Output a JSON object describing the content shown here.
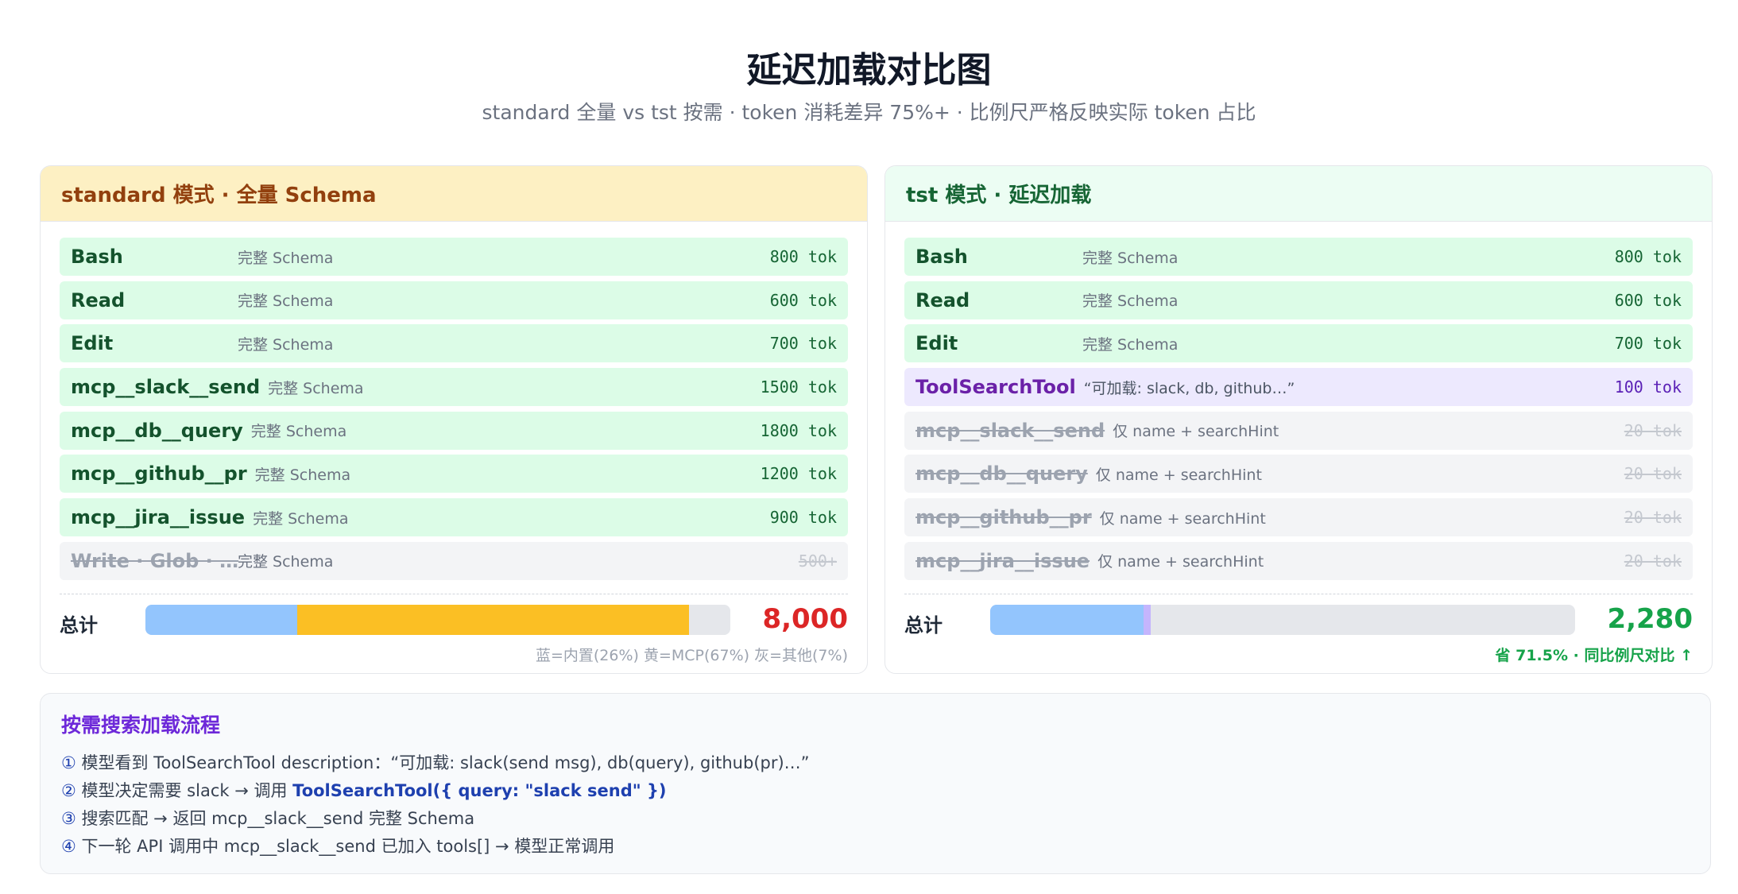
{
  "title": "延迟加载对比图",
  "subtitle": "standard 全量 vs tst 按需 · token 消耗差异 75%+ · 比例尺严格反映实际 token 占比",
  "standard": {
    "header": "standard 模式 · 全量 Schema",
    "rows": [
      {
        "name": "Bash",
        "desc": "完整 Schema",
        "tok": "800 tok"
      },
      {
        "name": "Read",
        "desc": "完整 Schema",
        "tok": "600 tok"
      },
      {
        "name": "Edit",
        "desc": "完整 Schema",
        "tok": "700 tok"
      },
      {
        "name": "mcp__slack__send",
        "desc": "完整 Schema",
        "tok": "1500 tok"
      },
      {
        "name": "mcp__db__query",
        "desc": "完整 Schema",
        "tok": "1800 tok"
      },
      {
        "name": "mcp__github__pr",
        "desc": "完整 Schema",
        "tok": "1200 tok"
      },
      {
        "name": "mcp__jira__issue",
        "desc": "完整 Schema",
        "tok": "900 tok"
      },
      {
        "name": "Write · Glob · …",
        "desc": "完整 Schema",
        "tok": "500+"
      }
    ],
    "total_label": "总计",
    "total_value": "8,000",
    "bar_segments": [
      {
        "label": "内置",
        "percent": 26,
        "color": "#93c5fd"
      },
      {
        "label": "MCP",
        "percent": 67,
        "color": "#fbbf24"
      },
      {
        "label": "其他",
        "percent": 7,
        "color": "#e5e7eb"
      }
    ],
    "bar_note": "蓝=内置(26%) 黄=MCP(67%) 灰=其他(7%)"
  },
  "tst": {
    "header": "tst 模式 · 延迟加载",
    "rows": [
      {
        "name": "Bash",
        "desc": "完整 Schema",
        "tok": "800 tok",
        "kind": "full"
      },
      {
        "name": "Read",
        "desc": "完整 Schema",
        "tok": "600 tok",
        "kind": "full"
      },
      {
        "name": "Edit",
        "desc": "完整 Schema",
        "tok": "700 tok",
        "kind": "full"
      },
      {
        "name": "ToolSearchTool",
        "desc": "“可加载: slack, db, github…”",
        "tok": "100 tok",
        "kind": "tool"
      },
      {
        "name": "mcp__slack__send",
        "desc": "仅 name + searchHint",
        "tok": "20 tok",
        "kind": "deferred"
      },
      {
        "name": "mcp__db__query",
        "desc": "仅 name + searchHint",
        "tok": "20 tok",
        "kind": "deferred"
      },
      {
        "name": "mcp__github__pr",
        "desc": "仅 name + searchHint",
        "tok": "20 tok",
        "kind": "deferred"
      },
      {
        "name": "mcp__jira__issue",
        "desc": "仅 name + searchHint",
        "tok": "20 tok",
        "kind": "deferred"
      }
    ],
    "total_label": "总计",
    "total_value": "2,280",
    "bar_segments": [
      {
        "label": "内置",
        "tokens": 2100,
        "color": "#93c5fd"
      },
      {
        "label": "ToolSearchTool",
        "tokens": 100,
        "color": "#c4b5fd"
      }
    ],
    "bar_scale_max": 8000,
    "bar_note": "省 71.5% · 同比例尺对比 ↑"
  },
  "flow": {
    "title": "按需搜索加载流程",
    "steps": [
      {
        "num": "①",
        "text": " 模型看到 ToolSearchTool description：“可加载: slack(send msg), db(query), github(pr)…”",
        "code": "",
        "tail": ""
      },
      {
        "num": "②",
        "text": " 模型决定需要 slack → 调用 ",
        "code": "ToolSearchTool({ query: \"slack send\" })",
        "tail": ""
      },
      {
        "num": "③",
        "text": " 搜索匹配 → 返回 mcp__slack__send 完整 Schema",
        "code": "",
        "tail": ""
      },
      {
        "num": "④",
        "text": " 下一轮 API 调用中 mcp__slack__send 已加入 tools[] → 模型正常调用",
        "code": "",
        "tail": ""
      }
    ]
  }
}
